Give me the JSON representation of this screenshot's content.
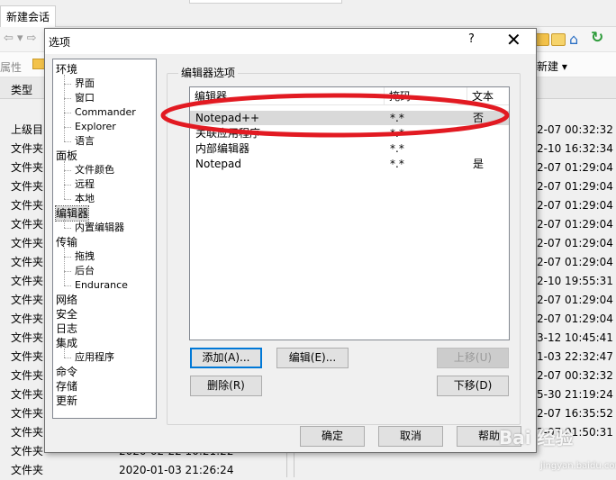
{
  "background": {
    "tab_label": "新建会话",
    "attr_label": "属性",
    "new_menu_label": "新建 ▾",
    "type_header": "类型",
    "left_items": [
      "上级目",
      "文件夹",
      "文件夹",
      "文件夹",
      "文件夹",
      "文件夹",
      "文件夹",
      "文件夹",
      "文件夹",
      "文件夹",
      "文件夹",
      "文件夹",
      "文件夹",
      "文件夹",
      "文件夹",
      "文件夹",
      "文件夹",
      "文件夹",
      "文件夹"
    ],
    "right_dates": [
      "2-07 00:32:32",
      "2-10 16:32:34",
      "2-07 01:29:04",
      "2-07 01:29:04",
      "2-07 01:29:04",
      "2-07 01:29:04",
      "2-07 01:29:04",
      "2-07 01:29:04",
      "2-10 19:55:31",
      "2-07 01:29:04",
      "2-07 01:29:04",
      "3-12 10:45:41",
      "1-03 22:32:47",
      "2-07 00:32:32",
      "5-30 21:19:24",
      "2-07 16:35:52",
      "2-07 01:50:31"
    ],
    "bottom_dates": [
      "2020-02-22  10:21:22",
      "2020-01-03  21:26:24"
    ]
  },
  "dialog": {
    "title": "选项",
    "help_label": "?",
    "close_label": "✕",
    "tree": {
      "items": [
        {
          "label": "环境",
          "level": 0
        },
        {
          "label": "界面",
          "level": 1
        },
        {
          "label": "窗口",
          "level": 1
        },
        {
          "label": "Commander",
          "level": 1
        },
        {
          "label": "Explorer",
          "level": 1
        },
        {
          "label": "语言",
          "level": 1
        },
        {
          "label": "面板",
          "level": 0
        },
        {
          "label": "文件颜色",
          "level": 1
        },
        {
          "label": "远程",
          "level": 1
        },
        {
          "label": "本地",
          "level": 1
        },
        {
          "label": "编辑器",
          "level": 0,
          "selected": true
        },
        {
          "label": "内置编辑器",
          "level": 1
        },
        {
          "label": "传输",
          "level": 0
        },
        {
          "label": "拖拽",
          "level": 1
        },
        {
          "label": "后台",
          "level": 1
        },
        {
          "label": "Endurance",
          "level": 1
        },
        {
          "label": "网络",
          "level": 0
        },
        {
          "label": "安全",
          "level": 0
        },
        {
          "label": "日志",
          "level": 0
        },
        {
          "label": "集成",
          "level": 0
        },
        {
          "label": "应用程序",
          "level": 1
        },
        {
          "label": "命令",
          "level": 0
        },
        {
          "label": "存储",
          "level": 0
        },
        {
          "label": "更新",
          "level": 0
        }
      ]
    },
    "group_title": "编辑器选项",
    "editor_list": {
      "columns": [
        "编辑器",
        "掩码",
        "文本"
      ],
      "rows": [
        {
          "editor": "Notepad++",
          "mask": "*.*",
          "text": "否",
          "selected": true
        },
        {
          "editor": "关联应用程序",
          "mask": "*.*",
          "text": ""
        },
        {
          "editor": "内部编辑器",
          "mask": "*.*",
          "text": ""
        },
        {
          "editor": "Notepad",
          "mask": "*.*",
          "text": "是"
        }
      ]
    },
    "buttons": {
      "add": "添加(A)...",
      "edit": "编辑(E)...",
      "move_up": "上移(U)",
      "delete": "删除(R)",
      "move_down": "下移(D)",
      "ok": "确定",
      "cancel": "取消",
      "help": "帮助"
    }
  },
  "annotation_color": "#e21a22",
  "watermark": {
    "main": "Bai 经验",
    "sub": "jingyan.baidu.com"
  }
}
